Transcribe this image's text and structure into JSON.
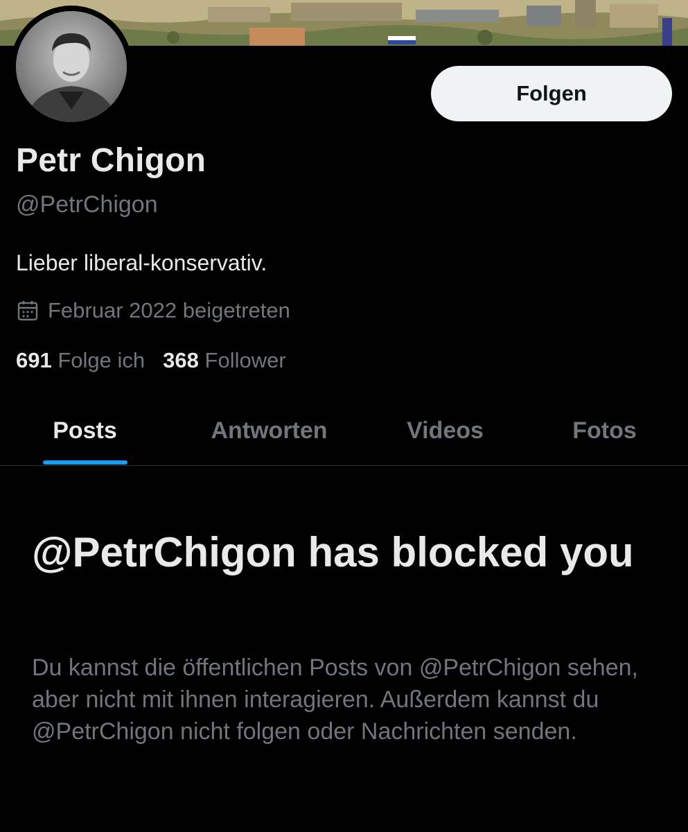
{
  "profile": {
    "display_name": "Petr Chigon",
    "handle": "@PetrChigon",
    "bio": "Lieber liberal-konservativ.",
    "joined": "Februar 2022 beigetreten",
    "joined_icon": "calendar-icon",
    "following_count": "691",
    "following_label": "Folge ich",
    "followers_count": "368",
    "followers_label": "Follower"
  },
  "actions": {
    "follow_label": "Folgen"
  },
  "tabs": [
    {
      "label": "Posts",
      "active": true
    },
    {
      "label": "Antworten",
      "active": false
    },
    {
      "label": "Videos",
      "active": false
    },
    {
      "label": "Fotos",
      "active": false
    }
  ],
  "blocked": {
    "title": "@PetrChigon has blocked you",
    "description": "Du kannst die öffentlichen Posts von @PetrChigon sehen, aber nicht mit ihnen interagieren. Außerdem kannst du @PetrChigon nicht folgen oder Nachrichten senden."
  },
  "colors": {
    "background": "#000000",
    "primary_text": "#e7e9ea",
    "secondary_text": "#71767b",
    "accent": "#1d9bf0",
    "button_bg": "#eff3f4",
    "divider": "#2f3336"
  }
}
